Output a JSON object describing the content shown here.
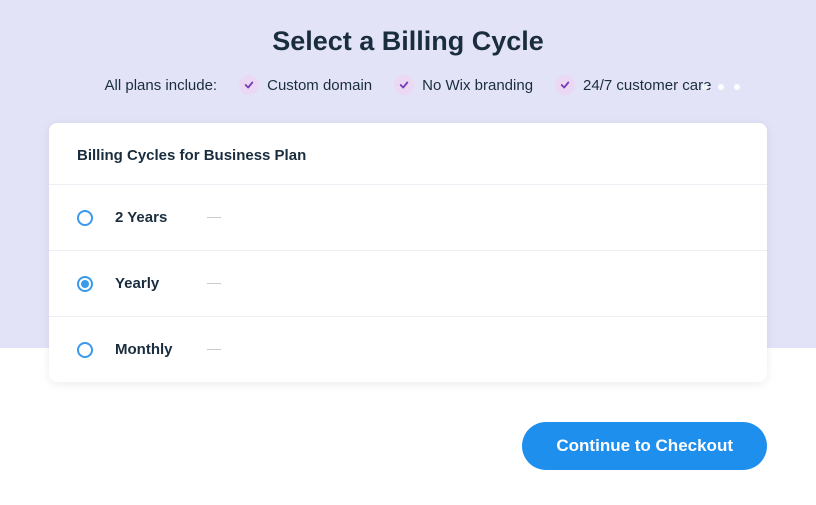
{
  "header": {
    "title": "Select a Billing Cycle",
    "includes_label": "All plans include:",
    "includes": [
      {
        "label": "Custom domain"
      },
      {
        "label": "No Wix branding"
      },
      {
        "label": "24/7 customer care"
      }
    ]
  },
  "card": {
    "title": "Billing Cycles for Business Plan",
    "cycles": [
      {
        "label": "2 Years",
        "selected": false
      },
      {
        "label": "Yearly",
        "selected": true
      },
      {
        "label": "Monthly",
        "selected": false
      }
    ]
  },
  "footer": {
    "checkout_label": "Continue to Checkout"
  }
}
